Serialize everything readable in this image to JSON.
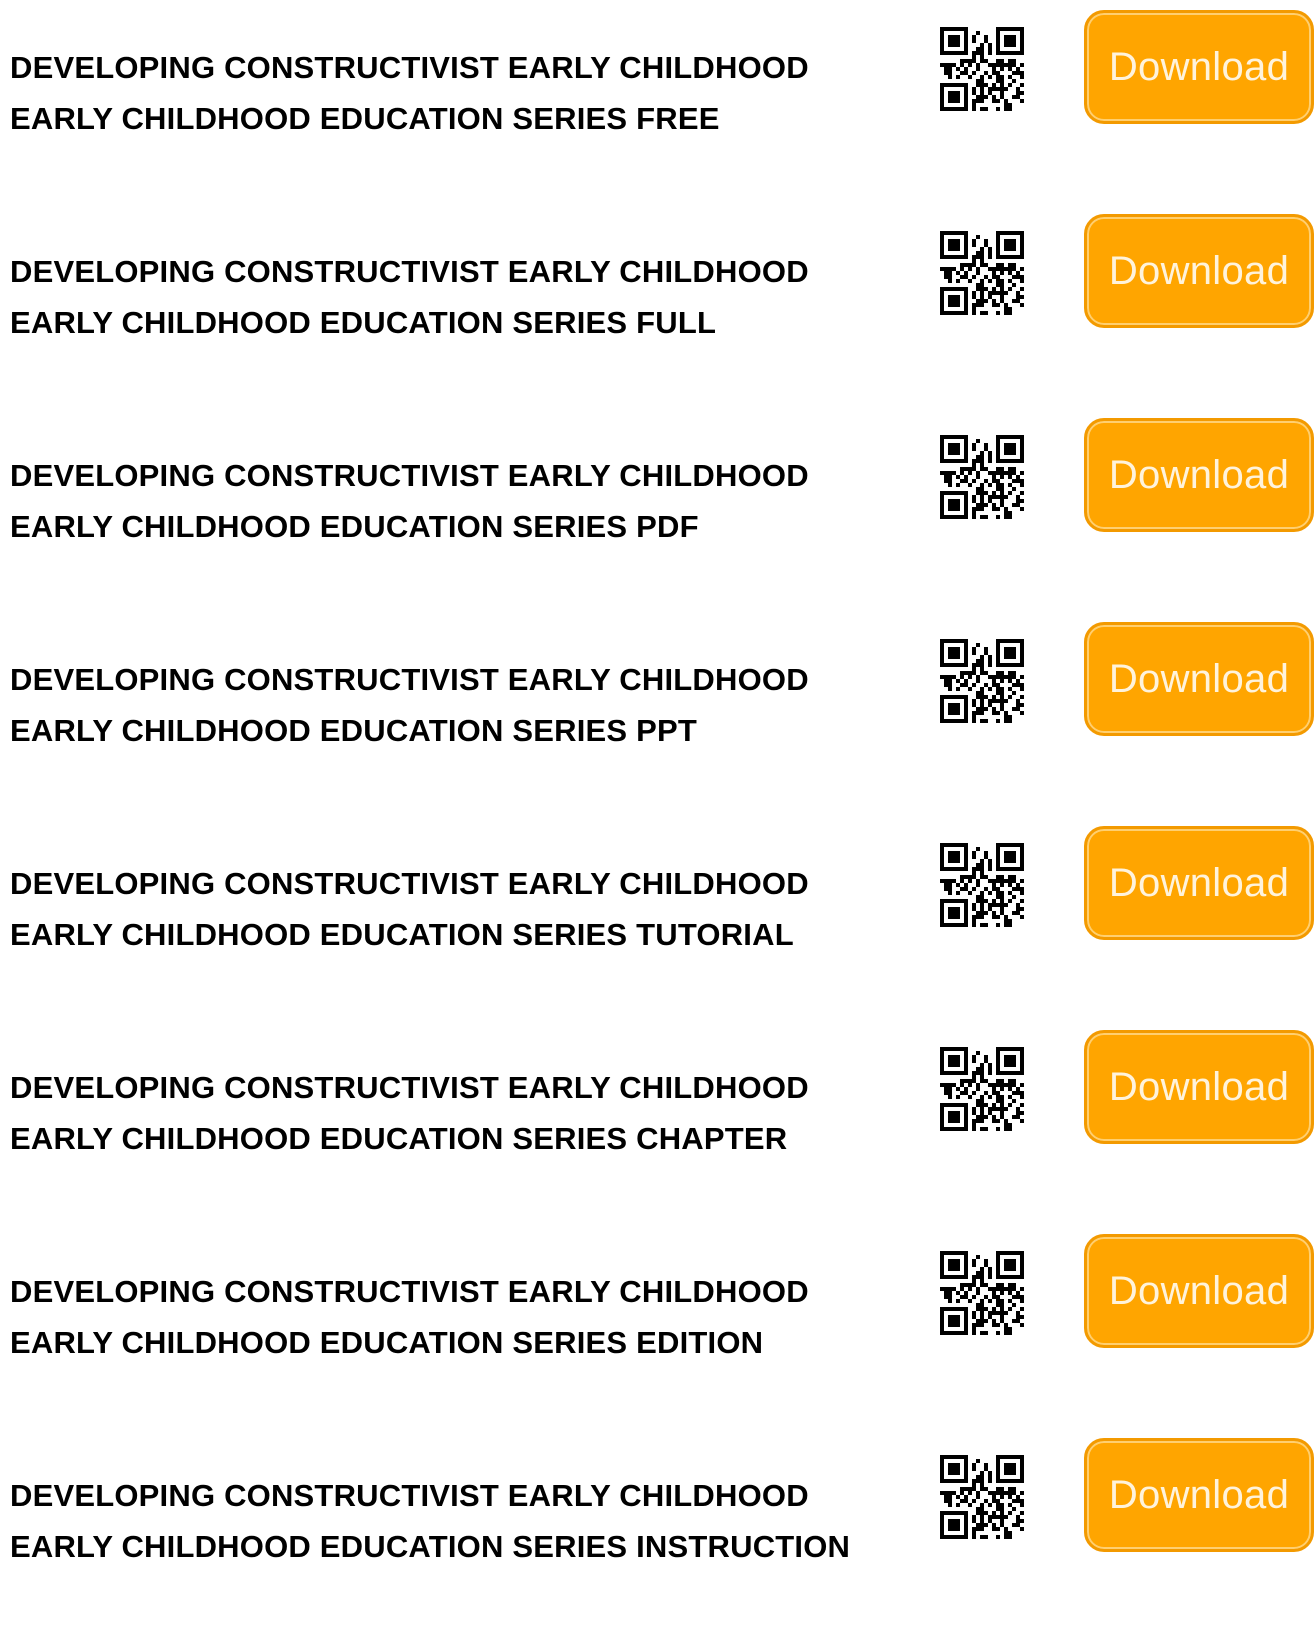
{
  "items": [
    {
      "line1": "DEVELOPING CONSTRUCTIVIST EARLY CHILDHOOD",
      "line2": "EARLY CHILDHOOD EDUCATION SERIES FREE",
      "button": "Download"
    },
    {
      "line1": "DEVELOPING CONSTRUCTIVIST EARLY CHILDHOOD",
      "line2": "EARLY CHILDHOOD EDUCATION SERIES FULL",
      "button": "Download"
    },
    {
      "line1": "DEVELOPING CONSTRUCTIVIST EARLY CHILDHOOD",
      "line2": "EARLY CHILDHOOD EDUCATION SERIES PDF",
      "button": "Download"
    },
    {
      "line1": "DEVELOPING CONSTRUCTIVIST EARLY CHILDHOOD",
      "line2": "EARLY CHILDHOOD EDUCATION SERIES PPT",
      "button": "Download"
    },
    {
      "line1": "DEVELOPING CONSTRUCTIVIST EARLY CHILDHOOD",
      "line2": "EARLY CHILDHOOD EDUCATION SERIES TUTORIAL",
      "button": "Download"
    },
    {
      "line1": "DEVELOPING CONSTRUCTIVIST EARLY CHILDHOOD",
      "line2": "EARLY CHILDHOOD EDUCATION SERIES CHAPTER",
      "button": "Download"
    },
    {
      "line1": "DEVELOPING CONSTRUCTIVIST EARLY CHILDHOOD",
      "line2": "EARLY CHILDHOOD EDUCATION SERIES EDITION",
      "button": "Download"
    },
    {
      "line1": "DEVELOPING CONSTRUCTIVIST EARLY CHILDHOOD",
      "line2": "EARLY CHILDHOOD EDUCATION SERIES INSTRUCTION",
      "button": "Download"
    }
  ],
  "colors": {
    "button_fill": "#ffa500",
    "button_text": "#fff3dc",
    "title_text": "#000000"
  },
  "icons": {
    "qr": "qr-code-icon"
  }
}
